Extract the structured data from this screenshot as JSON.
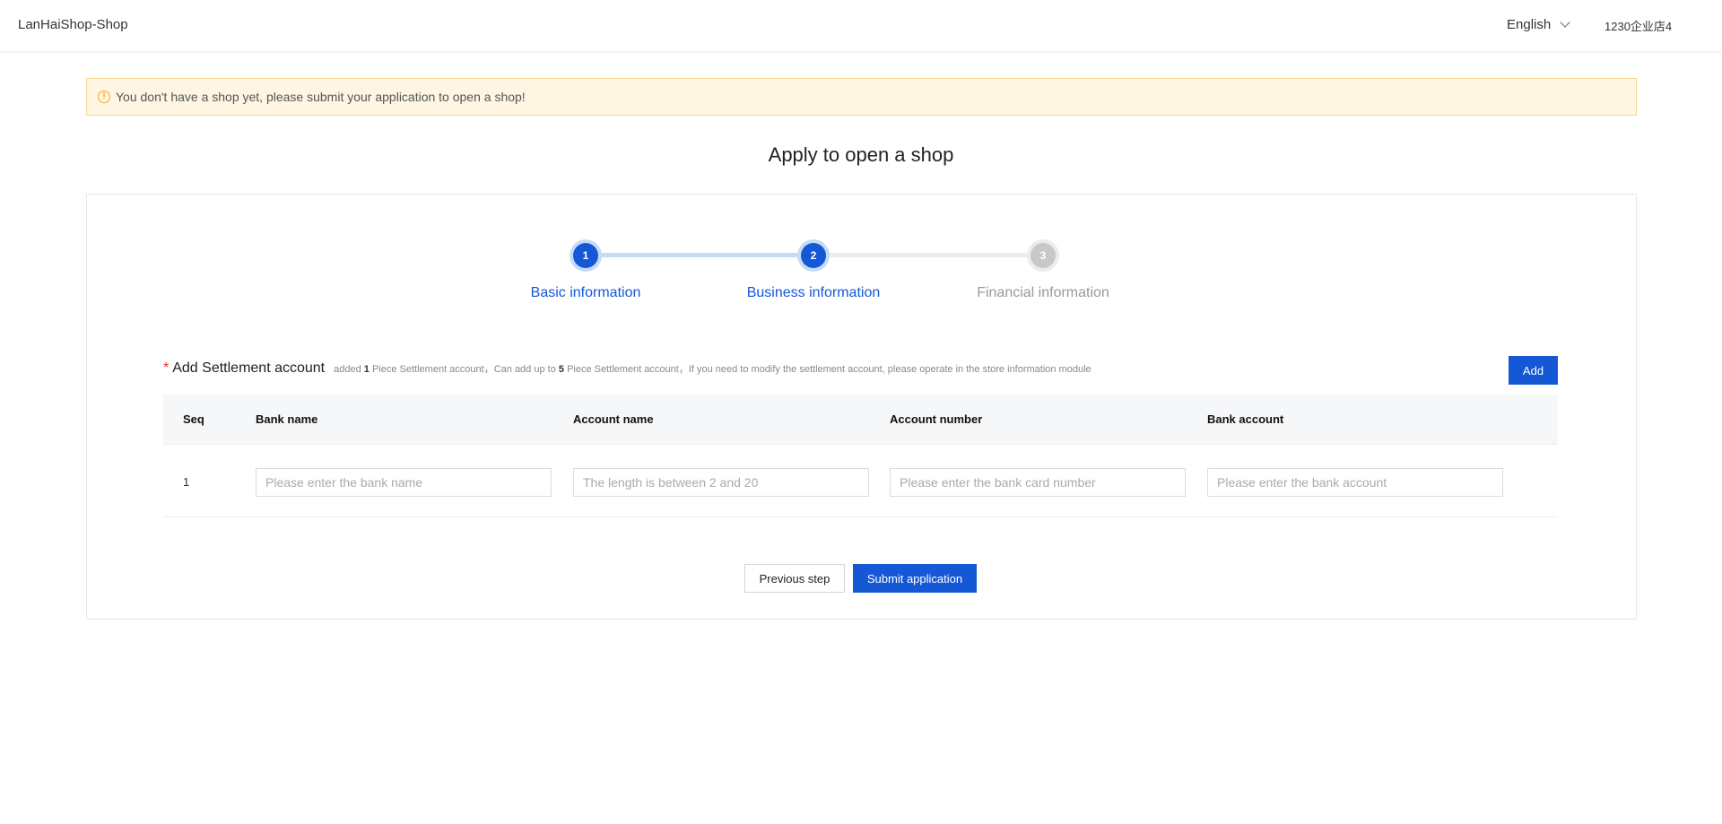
{
  "header": {
    "brand": "LanHaiShop-Shop",
    "language": "English",
    "user": "1230企业店4"
  },
  "alert": {
    "icon": "warning-circle-icon",
    "text": "You don't have a shop yet, please submit your application to open a shop!"
  },
  "page_title": "Apply to open a shop",
  "steps": [
    {
      "number": "1",
      "label": "Basic information",
      "state": "done"
    },
    {
      "number": "2",
      "label": "Business information",
      "state": "active"
    },
    {
      "number": "3",
      "label": "Financial information",
      "state": "pending"
    }
  ],
  "settlement": {
    "required_mark": "*",
    "title": "Add Settlement account",
    "hint_prefix": "added",
    "added_count": "1",
    "hint_mid1": "Piece Settlement account，Can add up to",
    "max_count": "5",
    "hint_mid2": "Piece Settlement account，If you need to modify the settlement account, please operate in the store information module",
    "add_label": "Add"
  },
  "table": {
    "columns": [
      "Seq",
      "Bank name",
      "Account name",
      "Account number",
      "Bank account"
    ],
    "rows": [
      {
        "seq": "1",
        "bank_name_placeholder": "Please enter the bank name",
        "account_name_placeholder": "The length is between 2 and 20",
        "account_number_placeholder": "Please enter the bank card number",
        "bank_account_placeholder": "Please enter the bank account"
      }
    ]
  },
  "footer": {
    "previous_label": "Previous step",
    "submit_label": "Submit application"
  },
  "colors": {
    "primary": "#1558d6",
    "alert_bg": "#fef6e3",
    "alert_icon": "#f5a623",
    "required": "#e33333"
  }
}
